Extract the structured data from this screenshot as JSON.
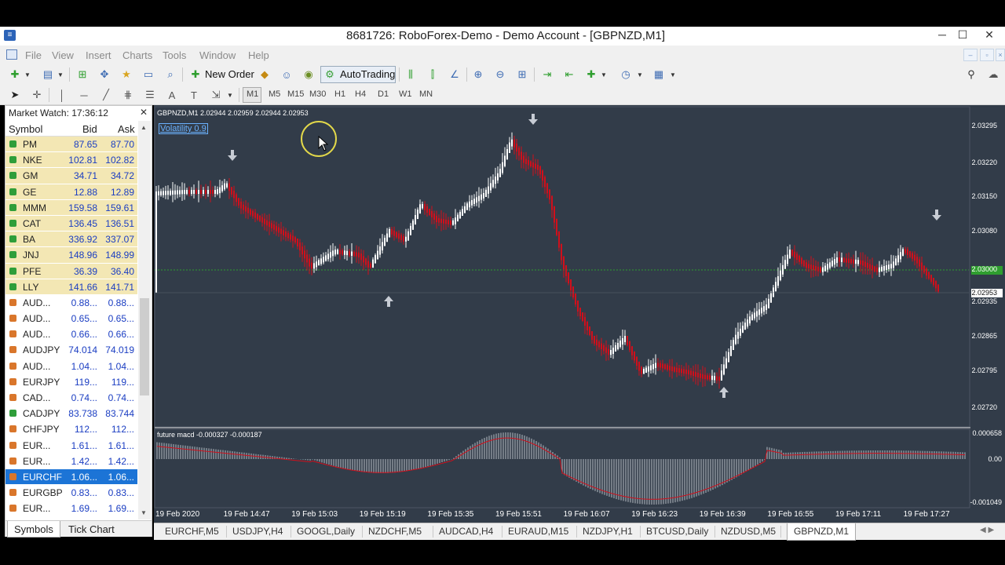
{
  "window": {
    "title": "8681726: RoboForex-Demo - Demo Account - [GBPNZD,M1]"
  },
  "menu": [
    "File",
    "View",
    "Insert",
    "Charts",
    "Tools",
    "Window",
    "Help"
  ],
  "toolbar": {
    "new_order": "New Order",
    "autotrading": "AutoTrading"
  },
  "timeframes": [
    "M1",
    "M5",
    "M15",
    "M30",
    "H1",
    "H4",
    "D1",
    "W1",
    "MN"
  ],
  "market_watch": {
    "title": "Market Watch: 17:36:12",
    "columns": [
      "Symbol",
      "Bid",
      "Ask"
    ],
    "rows": [
      {
        "symbol": "PM",
        "bid": "87.65",
        "ask": "87.70",
        "dir": "up",
        "bg": "#f3e7b4"
      },
      {
        "symbol": "NKE",
        "bid": "102.81",
        "ask": "102.82",
        "dir": "up",
        "bg": "#f3e7b4"
      },
      {
        "symbol": "GM",
        "bid": "34.71",
        "ask": "34.72",
        "dir": "up",
        "bg": "#f3e7b4"
      },
      {
        "symbol": "GE",
        "bid": "12.88",
        "ask": "12.89",
        "dir": "up",
        "bg": "#f3e7b4"
      },
      {
        "symbol": "MMM",
        "bid": "159.58",
        "ask": "159.61",
        "dir": "up",
        "bg": "#f3e7b4"
      },
      {
        "symbol": "CAT",
        "bid": "136.45",
        "ask": "136.51",
        "dir": "up",
        "bg": "#f3e7b4"
      },
      {
        "symbol": "BA",
        "bid": "336.92",
        "ask": "337.07",
        "dir": "up",
        "bg": "#f3e7b4"
      },
      {
        "symbol": "JNJ",
        "bid": "148.96",
        "ask": "148.99",
        "dir": "up",
        "bg": "#f3e7b4"
      },
      {
        "symbol": "PFE",
        "bid": "36.39",
        "ask": "36.40",
        "dir": "up",
        "bg": "#f3e7b4"
      },
      {
        "symbol": "LLY",
        "bid": "141.66",
        "ask": "141.71",
        "dir": "up",
        "bg": "#f3e7b4"
      },
      {
        "symbol": "AUD...",
        "bid": "0.88...",
        "ask": "0.88...",
        "dir": "down",
        "bg": "#ffffff"
      },
      {
        "symbol": "AUD...",
        "bid": "0.65...",
        "ask": "0.65...",
        "dir": "down",
        "bg": "#ffffff"
      },
      {
        "symbol": "AUD...",
        "bid": "0.66...",
        "ask": "0.66...",
        "dir": "down",
        "bg": "#ffffff"
      },
      {
        "symbol": "AUDJPY",
        "bid": "74.014",
        "ask": "74.019",
        "dir": "down",
        "bg": "#ffffff"
      },
      {
        "symbol": "AUD...",
        "bid": "1.04...",
        "ask": "1.04...",
        "dir": "down",
        "bg": "#ffffff"
      },
      {
        "symbol": "EURJPY",
        "bid": "119...",
        "ask": "119...",
        "dir": "down",
        "bg": "#ffffff"
      },
      {
        "symbol": "CAD...",
        "bid": "0.74...",
        "ask": "0.74...",
        "dir": "down",
        "bg": "#ffffff"
      },
      {
        "symbol": "CADJPY",
        "bid": "83.738",
        "ask": "83.744",
        "dir": "up",
        "bg": "#ffffff"
      },
      {
        "symbol": "CHFJPY",
        "bid": "112...",
        "ask": "112...",
        "dir": "down",
        "bg": "#ffffff"
      },
      {
        "symbol": "EUR...",
        "bid": "1.61...",
        "ask": "1.61...",
        "dir": "down",
        "bg": "#ffffff"
      },
      {
        "symbol": "EUR...",
        "bid": "1.42...",
        "ask": "1.42...",
        "dir": "down",
        "bg": "#ffffff"
      },
      {
        "symbol": "EURCHF",
        "bid": "1.06...",
        "ask": "1.06...",
        "dir": "down",
        "bg": "#1c74d6",
        "selected": true
      },
      {
        "symbol": "EURGBP",
        "bid": "0.83...",
        "ask": "0.83...",
        "dir": "down",
        "bg": "#ffffff"
      },
      {
        "symbol": "EUR...",
        "bid": "1.69...",
        "ask": "1.69...",
        "dir": "down",
        "bg": "#ffffff"
      }
    ],
    "tabs": [
      "Symbols",
      "Tick Chart"
    ]
  },
  "chart": {
    "header": "GBPNZD,M1  2.02944 2.02959 2.02944 2.02953",
    "volatility_button": "Volatility 0.9",
    "price_labels": [
      "2.03295",
      "2.03220",
      "2.03150",
      "2.03080",
      "2.03000",
      "2.02953",
      "2.02935",
      "2.02865",
      "2.02795",
      "2.02720"
    ],
    "macd_label": "future macd -0.000327 -0.000187",
    "macd_levels": [
      "0.000658",
      "0.00",
      "-0.001049"
    ],
    "time_labels": [
      "19 Feb 2020",
      "19 Feb 14:47",
      "19 Feb 15:03",
      "19 Feb 15:19",
      "19 Feb 15:35",
      "19 Feb 15:51",
      "19 Feb 16:07",
      "19 Feb 16:23",
      "19 Feb 16:39",
      "19 Feb 16:55",
      "19 Feb 17:11",
      "19 Feb 17:27"
    ],
    "colors": {
      "background": "#323c49",
      "bull": "#ffffff",
      "bear": "#d10f1b",
      "grid_level": "#2f9e2f"
    }
  },
  "bottom_tabs": [
    "EURCHF,M5",
    "USDJPY,H4",
    "GOOGL,Daily",
    "NZDCHF,M5",
    "AUDCAD,H4",
    "EURAUD,M15",
    "NZDJPY,H1",
    "BTCUSD,Daily",
    "NZDUSD,M5",
    "GBPNZD,M1"
  ],
  "active_tab": "GBPNZD,M1"
}
